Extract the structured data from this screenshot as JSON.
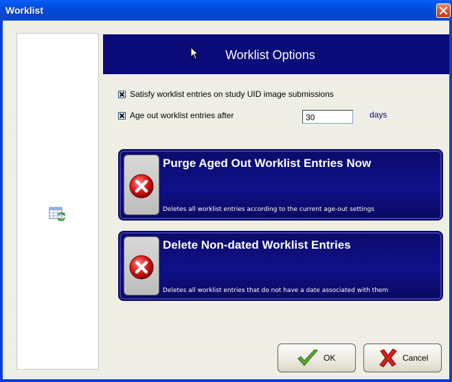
{
  "window": {
    "title": "Worklist",
    "close_glyph": "close-icon"
  },
  "header": {
    "title": "Worklist Options"
  },
  "options": {
    "satisfy_label": "Satisfy worklist entries on study UID image submissions",
    "satisfy_checked": true,
    "ageout_label": "Age out worklist entries after",
    "ageout_checked": true,
    "ageout_value": "30",
    "ageout_unit": "days"
  },
  "actions": [
    {
      "title": "Purge Aged Out Worklist Entries Now",
      "description": "Deletes all worklist entries according to the current age-out settings",
      "icon": "error-x-icon"
    },
    {
      "title": "Delete Non-dated Worklist Entries",
      "description": "Deletes all worklist entries that do not have a date associated with them",
      "icon": "error-x-icon"
    }
  ],
  "buttons": {
    "ok_label": "OK",
    "cancel_label": "Cancel"
  },
  "colors": {
    "header_bg": "#0a0a78",
    "action_bg": "#10108a",
    "titlebar": "#0053e4",
    "close_bg": "#d54a23",
    "days_color": "#000080"
  }
}
